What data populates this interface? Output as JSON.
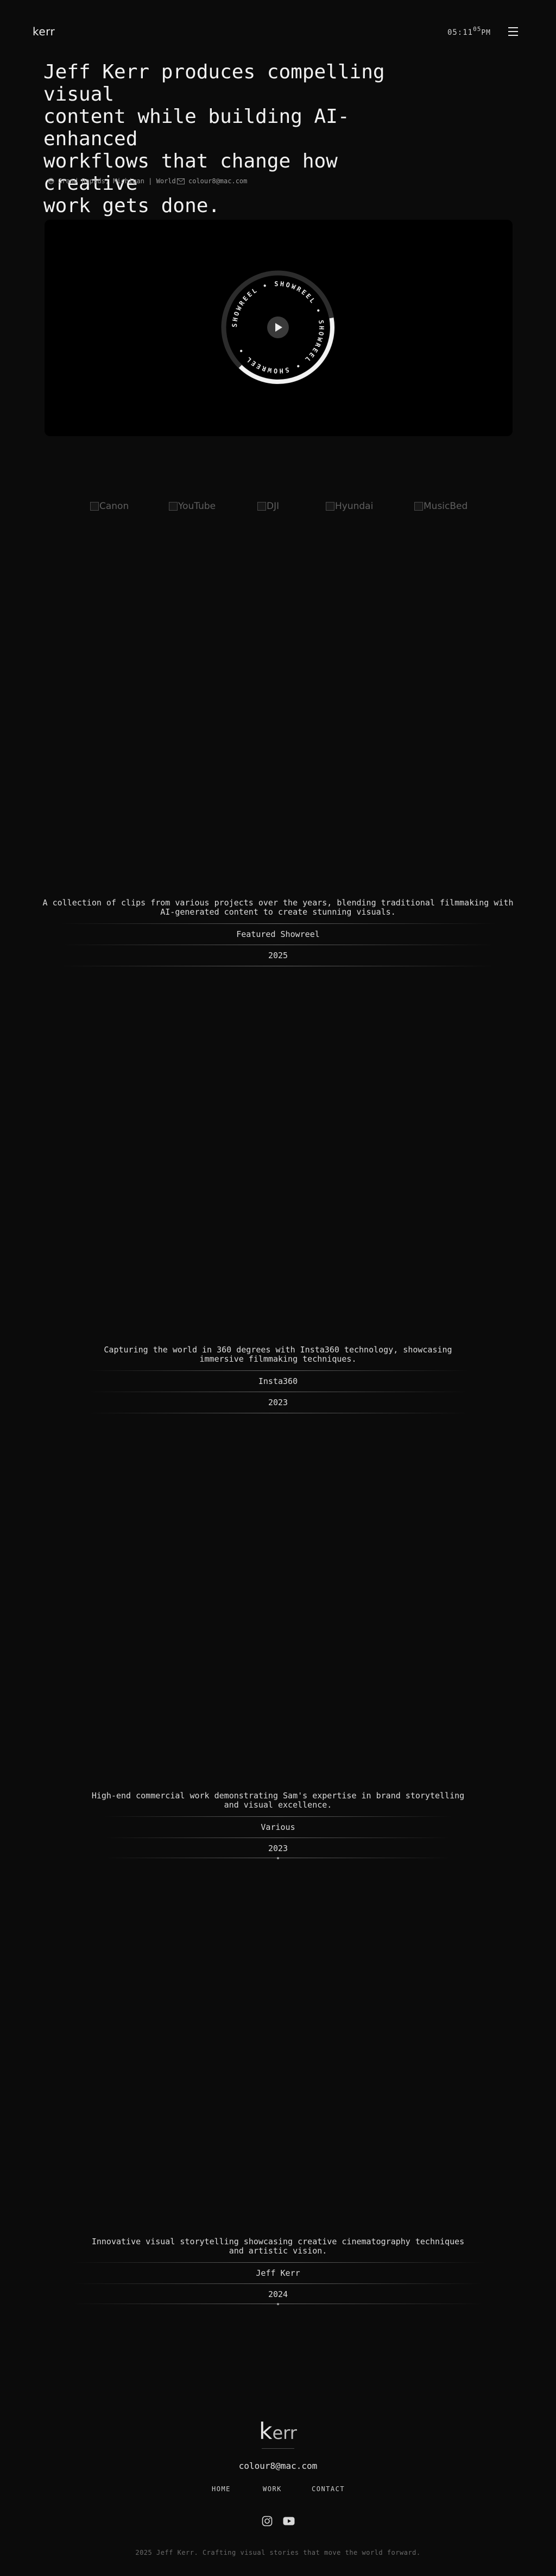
{
  "header": {
    "logo": "kerr",
    "clock_hours": "05",
    "clock_sep": ":",
    "clock_minutes": "11",
    "clock_seconds": "05",
    "clock_ampm": "PM",
    "menu_icon": "hamburger-icon"
  },
  "hero": {
    "headline_lines": [
      "Jeff Kerr produces compelling visual",
      "content while building AI-enhanced",
      "workflows that change how creative",
      "work gets done."
    ],
    "location": "Grand Rapids, Michigan | World",
    "email": "colour8@mac.com",
    "location_icon": "globe-icon",
    "email_icon": "mail-icon"
  },
  "showreel": {
    "ring_text": "SHOWREEL • SHOWREEL • SHOWREEL • SHOWREEL •",
    "play_icon": "play-icon",
    "progress_fraction": 0.4
  },
  "brands": [
    "Canon",
    "YouTube",
    "DJI",
    "Hyundai",
    "MusicBed"
  ],
  "projects": [
    {
      "description_lines": [
        "A collection of clips from various projects over the years, blending traditional filmmaking with",
        "AI-generated content to create stunning visuals."
      ],
      "client": "Featured Showreel",
      "year": "2025"
    },
    {
      "description_lines": [
        "Capturing the world in 360 degrees with Insta360 technology, showcasing",
        "immersive filmmaking techniques."
      ],
      "client": "Insta360",
      "year": "2023"
    },
    {
      "description_lines": [
        "High-end commercial work demonstrating Sam's expertise in brand storytelling",
        "and visual excellence."
      ],
      "client": "Various",
      "year": "2023"
    },
    {
      "description_lines": [
        "Innovative visual storytelling showcasing creative cinematography techniques",
        "and artistic vision."
      ],
      "client": "Jeff Kerr",
      "year": "2024"
    }
  ],
  "footer": {
    "logo_k": "k",
    "logo_rest": "err",
    "email": "colour8@mac.com",
    "nav": [
      "HOME",
      "WORK",
      "CONTACT"
    ],
    "social_icons": [
      "instagram-icon",
      "youtube-icon"
    ],
    "copyright": "2025 Jeff Kerr. Crafting visual stories that move the world forward."
  }
}
